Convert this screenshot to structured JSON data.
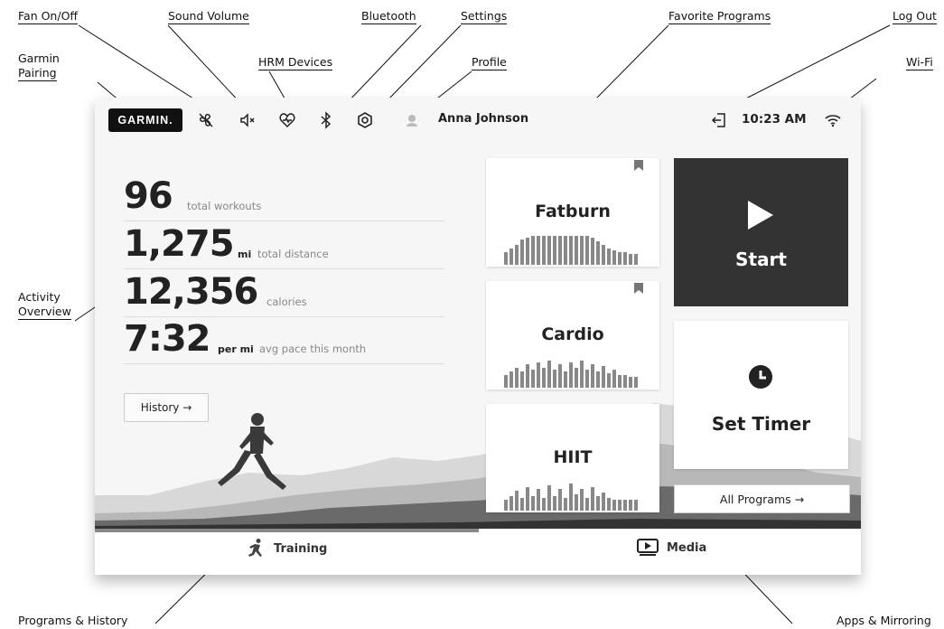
{
  "callouts": {
    "fan": "Fan On/Off",
    "sound": "Sound Volume",
    "bluetooth": "Bluetooth",
    "settings": "Settings",
    "favorites": "Favorite Programs",
    "logout": "Log Out",
    "garmin_line1": "Garmin",
    "garmin_line2": "Pairing",
    "hrm": "HRM Devices",
    "profile": "Profile",
    "wifi": "Wi-Fi",
    "activity_line1": "Activity",
    "activity_line2": "Overview",
    "programs_history": "Programs & History",
    "apps_mirroring": "Apps & Mirroring"
  },
  "topbar": {
    "brand": "GARMIN.",
    "icons": [
      "fan-icon",
      "sound-icon",
      "heart-rate-icon",
      "bluetooth-icon",
      "settings-icon",
      "profile-icon",
      "logout-icon",
      "wifi-icon"
    ],
    "profile_name": "Anna Johnson",
    "time": "10:23 AM"
  },
  "stats": [
    {
      "value": "96",
      "unit": "",
      "label": "total workouts"
    },
    {
      "value": "1,275",
      "unit": "mi",
      "label": "total distance"
    },
    {
      "value": "12,356",
      "unit": "",
      "label": "calories"
    },
    {
      "value": "7:32",
      "unit": "per mi",
      "label": "avg pace this month"
    }
  ],
  "history_button": "History →",
  "programs": [
    {
      "name": "Fatburn",
      "bookmarked": true
    },
    {
      "name": "Cardio",
      "bookmarked": true
    },
    {
      "name": "HIIT",
      "bookmarked": false
    }
  ],
  "start_label": "Start",
  "timer_label": "Set Timer",
  "all_programs_button": "All Programs →",
  "nav": {
    "training": "Training",
    "media": "Media"
  },
  "colors": {
    "dark_card": "#333333",
    "text": "#222222",
    "muted": "#888888"
  }
}
